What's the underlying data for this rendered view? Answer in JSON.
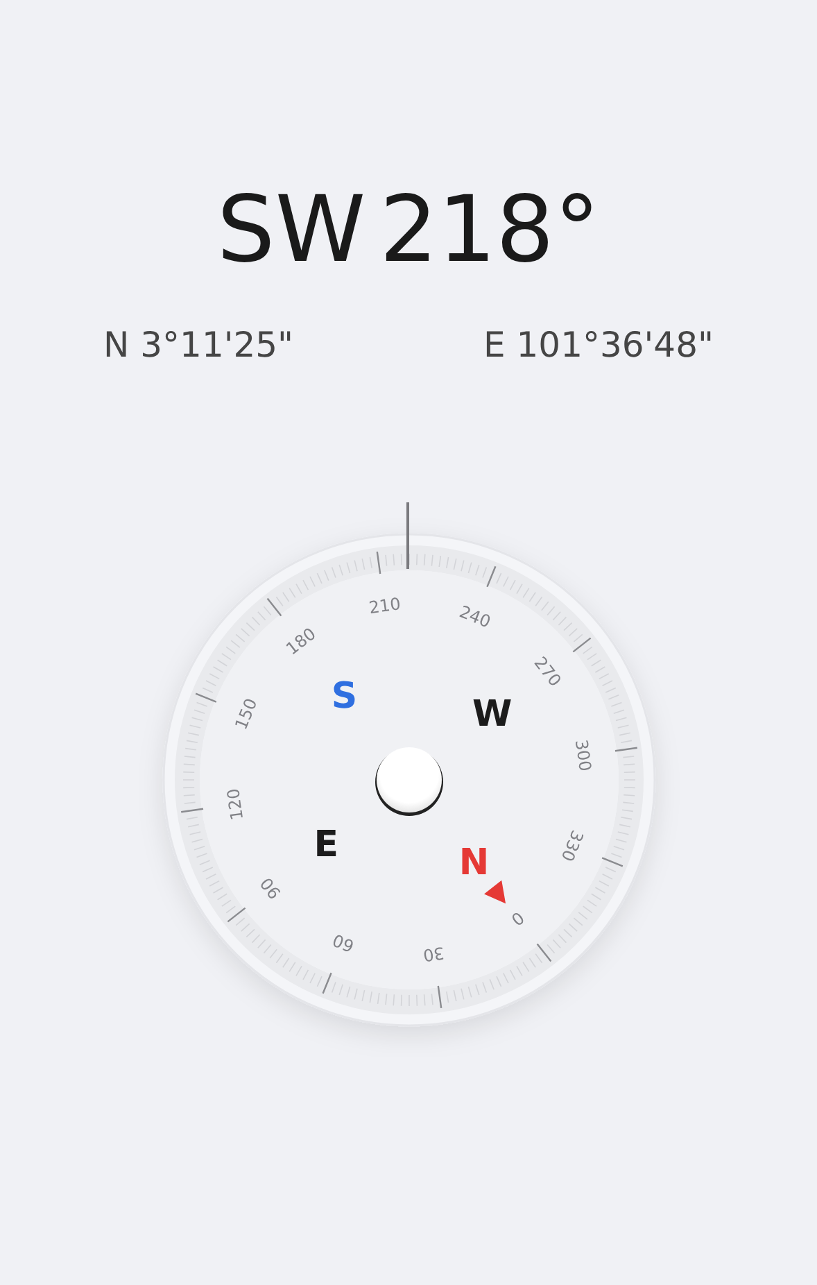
{
  "heading": {
    "direction": "SW",
    "degrees": "218°"
  },
  "coordinates": {
    "latitude": "N 3°11'25\"",
    "longitude": "E 101°36'48\""
  },
  "dial": {
    "north_marker": true,
    "degree_labels": [
      "0",
      "30",
      "60",
      "90",
      "120",
      "150",
      "180",
      "210",
      "240",
      "270",
      "300",
      "330"
    ],
    "cardinals": [
      {
        "kind": "south",
        "label": "S",
        "color": "#2f6fe0"
      },
      {
        "kind": "west",
        "label": "W",
        "color": "#1c1c1c"
      },
      {
        "kind": "east",
        "label": "E",
        "color": "#1c1c1c"
      },
      {
        "kind": "north",
        "label": "N",
        "color": "#e53935"
      }
    ]
  }
}
